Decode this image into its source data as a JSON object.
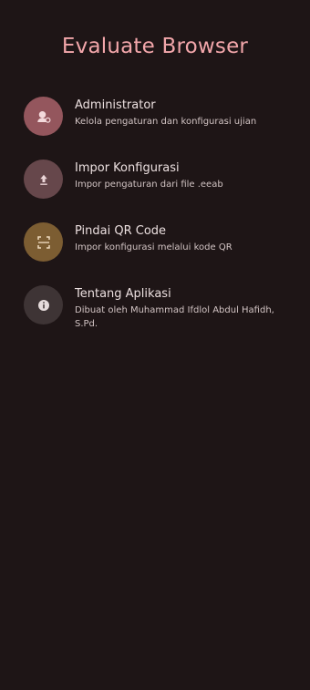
{
  "header": {
    "title": "Evaluate Browser"
  },
  "menu": {
    "items": [
      {
        "title": "Administrator",
        "subtitle": "Kelola pengaturan dan konfigurasi ujian",
        "icon": "admin-icon",
        "color": "#94565d"
      },
      {
        "title": "Impor Konfigurasi",
        "subtitle": "Impor pengaturan dari file .eeab",
        "icon": "upload-icon",
        "color": "#66474b"
      },
      {
        "title": "Pindai QR Code",
        "subtitle": "Impor konfigurasi melalui kode QR",
        "icon": "qr-scan-icon",
        "color": "#7c5d32"
      },
      {
        "title": "Tentang Aplikasi",
        "subtitle": "Dibuat oleh Muhammad Ifdlol Abdul Hafidh, S.Pd.",
        "icon": "info-icon",
        "color": "#3e3435"
      }
    ]
  }
}
